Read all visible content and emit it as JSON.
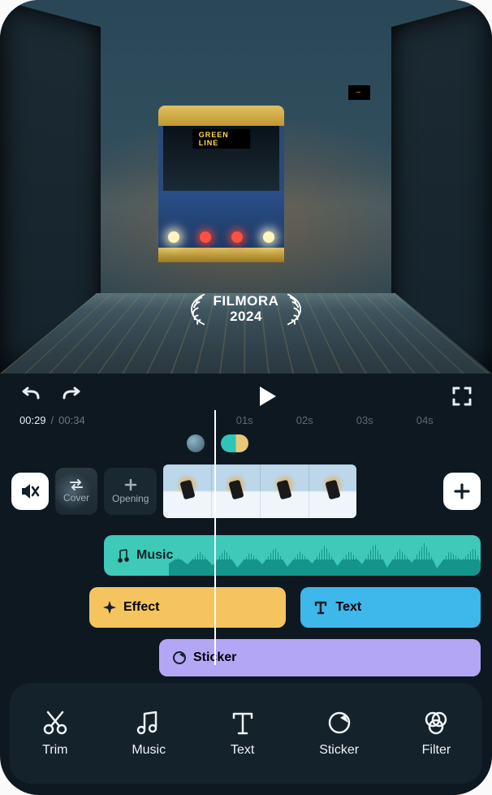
{
  "preview": {
    "badge_title": "FILMORA",
    "badge_year": "2024",
    "tram_dest": "GREEN LINE",
    "platform_sign": "—"
  },
  "transport": {
    "current_time": "00:29",
    "total_time": "00:34",
    "marks": [
      "01s",
      "02s",
      "03s",
      "04s"
    ]
  },
  "media_row": {
    "cover_label": "Cover",
    "opening_label": "Opening"
  },
  "lanes": {
    "music_label": "Music",
    "effect_label": "Effect",
    "text_label": "Text",
    "sticker_label": "Sticker"
  },
  "toolbar": {
    "trim": "Trim",
    "music": "Music",
    "text": "Text",
    "sticker": "Sticker",
    "filter": "Filter"
  }
}
